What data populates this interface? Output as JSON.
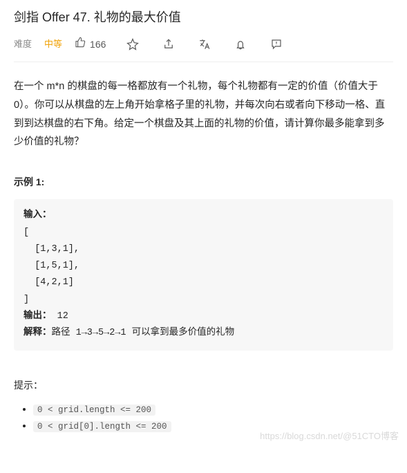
{
  "title": "剑指 Offer 47. 礼物的最大价值",
  "meta": {
    "difficulty_label": "难度",
    "difficulty_value": "中等",
    "likes_count": "166"
  },
  "description": "在一个 m*n 的棋盘的每一格都放有一个礼物，每个礼物都有一定的价值（价值大于 0）。你可以从棋盘的左上角开始拿格子里的礼物，并每次向右或者向下移动一格、直到到达棋盘的右下角。给定一个棋盘及其上面的礼物的价值，请计算你最多能拿到多少价值的礼物？",
  "example": {
    "heading": "示例 1:",
    "input_label": "输入：",
    "input_body": "[\n  [1,3,1],\n  [1,5,1],\n  [4,2,1]\n]",
    "output_label": "输出：",
    "output_value": " 12",
    "explain_label": "解释：",
    "explain_value": "路径 1→3→5→2→1 可以拿到最多价值的礼物"
  },
  "hints": {
    "heading": "提示：",
    "items": [
      "0 < grid.length <= 200",
      "0 < grid[0].length <= 200"
    ]
  },
  "watermark": "https://blog.csdn.net/@51CTO博客"
}
